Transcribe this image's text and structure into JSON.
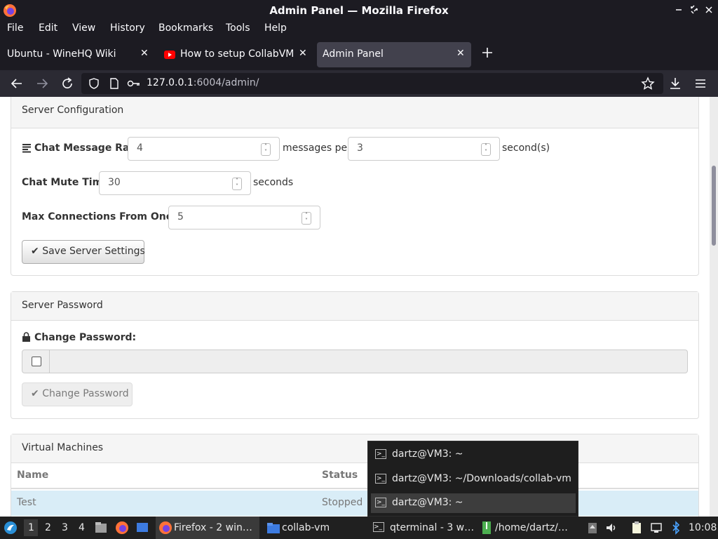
{
  "window": {
    "title": "Admin Panel — Mozilla Firefox"
  },
  "menubar": [
    "File",
    "Edit",
    "View",
    "History",
    "Bookmarks",
    "Tools",
    "Help"
  ],
  "tabs": [
    {
      "label": "Ubuntu - WineHQ Wiki",
      "icon": "wine-icon"
    },
    {
      "label": "How to setup CollabVM S",
      "icon": "youtube-icon"
    },
    {
      "label": "Admin Panel",
      "icon": "none"
    }
  ],
  "url": {
    "host": "127.0.0.1",
    "rest": ":6004/admin/"
  },
  "server_config": {
    "heading": "Server Configuration",
    "chat_rate_label": "Chat Message Rate:",
    "chat_rate_value": "4",
    "messages_per": "messages per",
    "chat_rate_seconds_value": "3",
    "seconds_suffix": "second(s)",
    "mute_label": "Chat Mute Time:",
    "mute_value": "30",
    "mute_suffix": "seconds",
    "max_conn_label": "Max Connections From One IP:",
    "max_conn_value": "5",
    "save_button": "Save Server Settings"
  },
  "server_password": {
    "heading": "Server Password",
    "change_label": "Change Password:",
    "change_button": "Change Password"
  },
  "virtual_machines": {
    "heading": "Virtual Machines",
    "columns": [
      "Name",
      "Status"
    ],
    "rows": [
      {
        "name": "Test",
        "status": "Stopped"
      }
    ]
  },
  "window_popup": {
    "items": [
      "dartz@VM3: ~",
      "dartz@VM3: ~/Downloads/collab-vm",
      "dartz@VM3: ~"
    ],
    "selected_index": 2
  },
  "taskbar": {
    "workspaces": [
      "1",
      "2",
      "3",
      "4"
    ],
    "active_workspace": "1",
    "tasks": [
      {
        "label": "Firefox - 2 win…",
        "icon": "firefox-icon"
      },
      {
        "label": "collab-vm",
        "icon": "folder-icon"
      },
      {
        "label": "qterminal - 3 w…",
        "icon": "terminal-icon"
      },
      {
        "label": "/home/dartz/…",
        "icon": "archive-icon"
      }
    ],
    "clock": "10:08"
  },
  "colors": {
    "chrome_dark": "#1c1b22",
    "active_tab": "#42414d",
    "selected_row": "#d9edf7"
  }
}
